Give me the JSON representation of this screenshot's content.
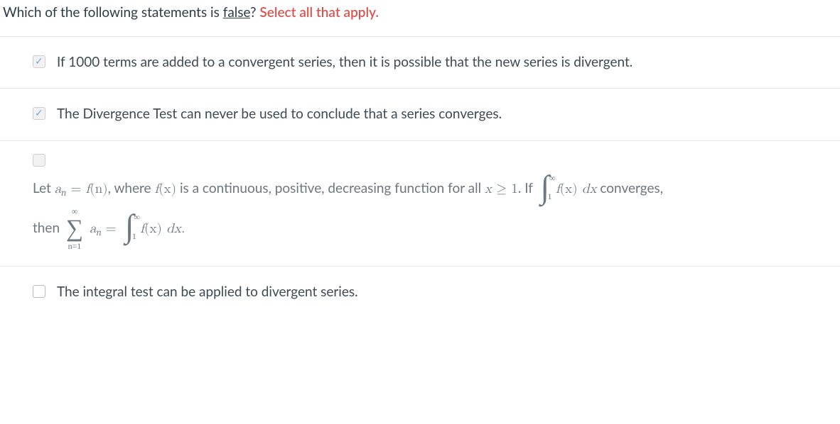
{
  "question": {
    "lead": "Which of the following statements is ",
    "false_word": "false",
    "tail": "? ",
    "instruction": "Select all that apply."
  },
  "options": [
    {
      "checked": true,
      "locked": true,
      "text": "If 1000 terms are added to a convergent series, then it is possible that the new series is divergent."
    },
    {
      "checked": true,
      "locked": true,
      "text": "The Divergence Test can never be used to conclude that a series converges."
    },
    {
      "checked": false,
      "locked": true,
      "math": {
        "lead": "Let ",
        "an": "a",
        "an_sub": "n",
        "eq": " = ",
        "fn": "f",
        "fn_arg_n": "(n)",
        "where": ", where ",
        "fx": "f",
        "fx_arg": "(x)",
        "desc": " is a continuous, positive, decreasing function for all ",
        "x": "x",
        "geq": " ≥ ",
        "one": "1",
        "if": ". If ",
        "fx2": "f",
        "fx2_arg": "(x)",
        "dx": " dx",
        "converges": " converges,",
        "then": "then ",
        "sum_top": "∞",
        "sum_bot": "n=1",
        "an2": "a",
        "an2_sub": "n",
        "eq2": " = ",
        "fx3": "f",
        "fx3_arg": "(x)",
        "dx2": " dx.",
        "int_upper": "∞",
        "int_lower": "1"
      }
    },
    {
      "checked": false,
      "locked": false,
      "text": "The integral test can be applied to divergent series."
    }
  ]
}
